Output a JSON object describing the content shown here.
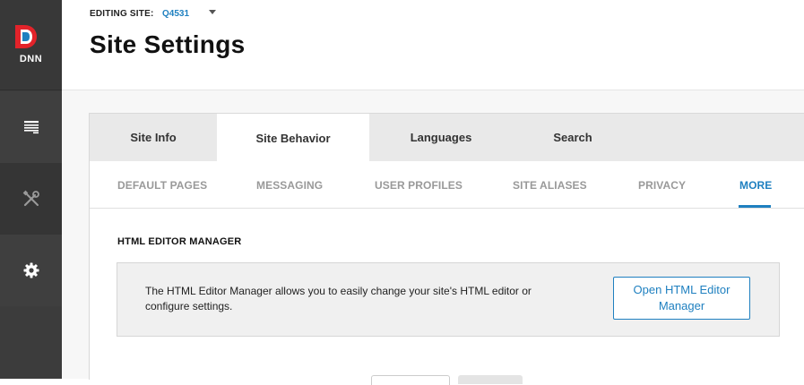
{
  "sidebar": {
    "logo_text": "DNN",
    "items": [
      {
        "icon": "pages-icon"
      },
      {
        "icon": "tools-icon"
      },
      {
        "icon": "gear-icon"
      }
    ]
  },
  "header": {
    "editing_label": "EDITING SITE:",
    "site_id": "Q4531",
    "title": "Site Settings"
  },
  "tabs": [
    {
      "label": "Site Info",
      "active": false
    },
    {
      "label": "Site Behavior",
      "active": true
    },
    {
      "label": "Languages",
      "active": false
    },
    {
      "label": "Search",
      "active": false
    }
  ],
  "subtabs": [
    {
      "label": "DEFAULT PAGES",
      "active": false
    },
    {
      "label": "MESSAGING",
      "active": false
    },
    {
      "label": "USER PROFILES",
      "active": false
    },
    {
      "label": "SITE ALIASES",
      "active": false
    },
    {
      "label": "PRIVACY",
      "active": false
    },
    {
      "label": "MORE",
      "active": true
    }
  ],
  "section": {
    "title": "HTML EDITOR MANAGER",
    "description": "The HTML Editor Manager allows you to easily change your site's HTML editor or configure settings.",
    "button_label": "Open HTML Editor Manager"
  },
  "colors": {
    "accent": "#1f80c0",
    "sidebar": "#3c3c3c",
    "logo_red": "#e2232a",
    "logo_blue": "#1f80c0"
  }
}
